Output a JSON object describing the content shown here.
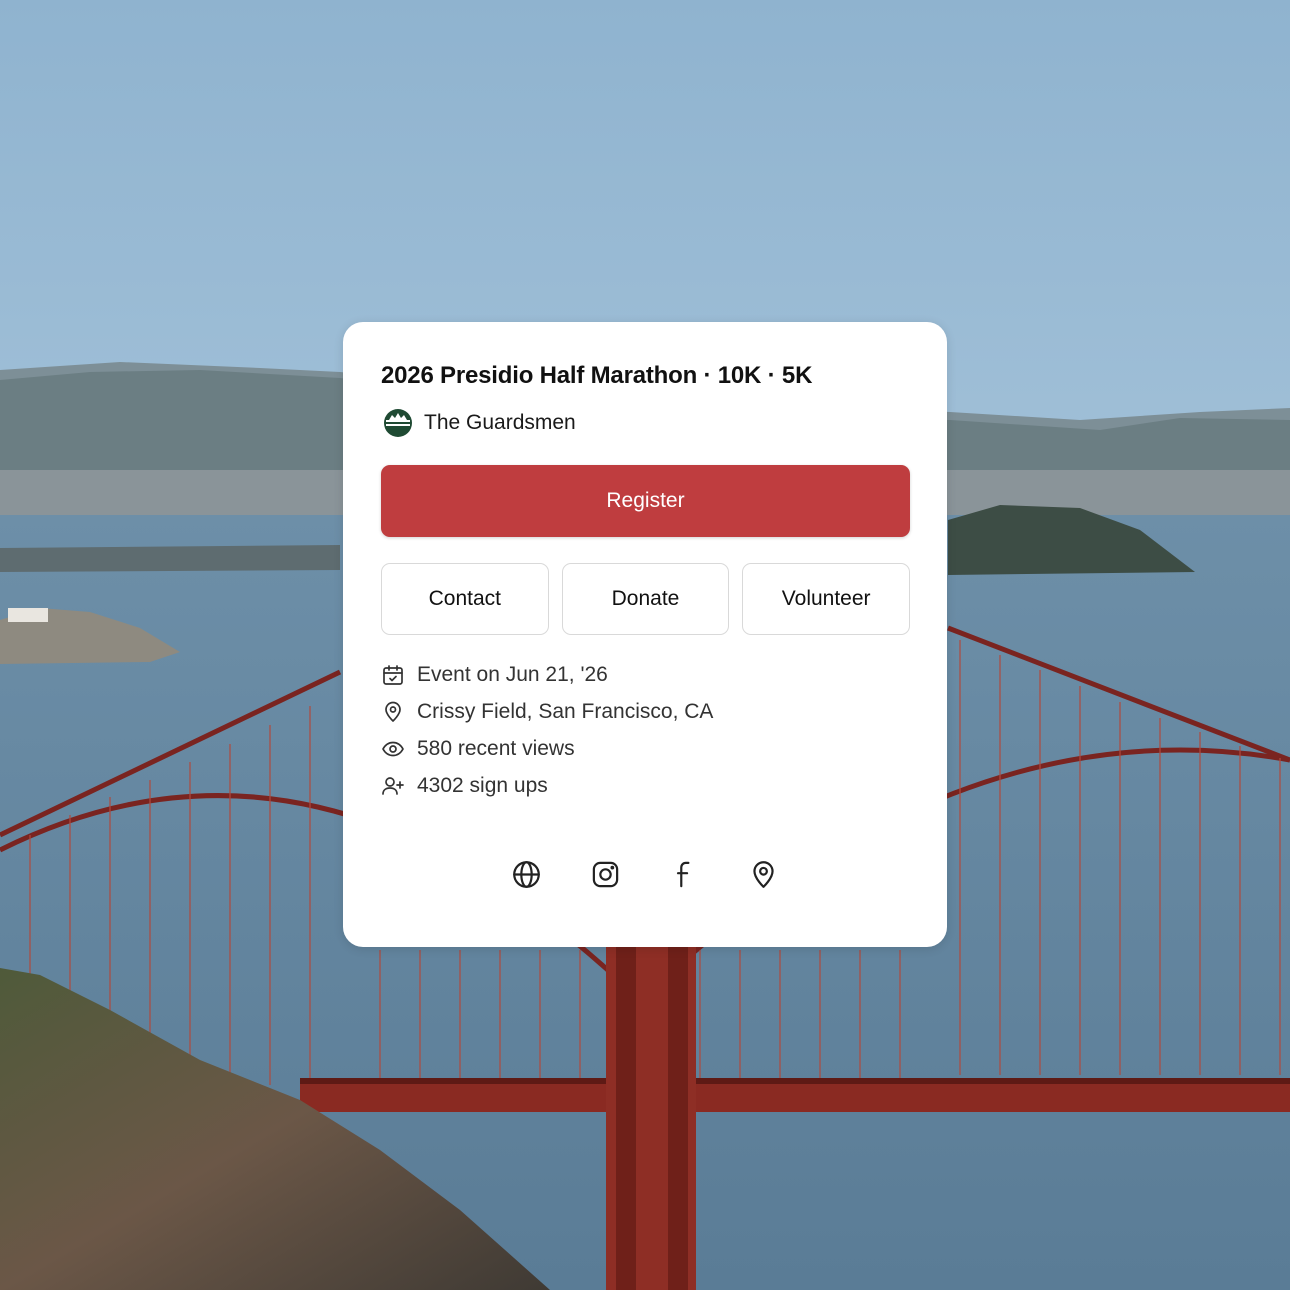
{
  "event": {
    "title": "2026 Presidio Half Marathon · 10K · 5K",
    "organizer": "The Guardsmen",
    "organizer_logo_icon": "guardsmen-logo-icon"
  },
  "actions": {
    "register_label": "Register",
    "contact_label": "Contact",
    "donate_label": "Donate",
    "volunteer_label": "Volunteer"
  },
  "details": {
    "date": "Event on Jun 21, '26",
    "location": "Crissy Field, San Francisco, CA",
    "views": "580 recent views",
    "signups": "4302 sign ups"
  },
  "socials": [
    "globe-icon",
    "instagram-icon",
    "facebook-icon",
    "map-pin-icon"
  ],
  "colors": {
    "accent": "#bf3d3f",
    "card_background": "#ffffff",
    "text_primary": "#111111",
    "text_secondary": "#333333"
  }
}
